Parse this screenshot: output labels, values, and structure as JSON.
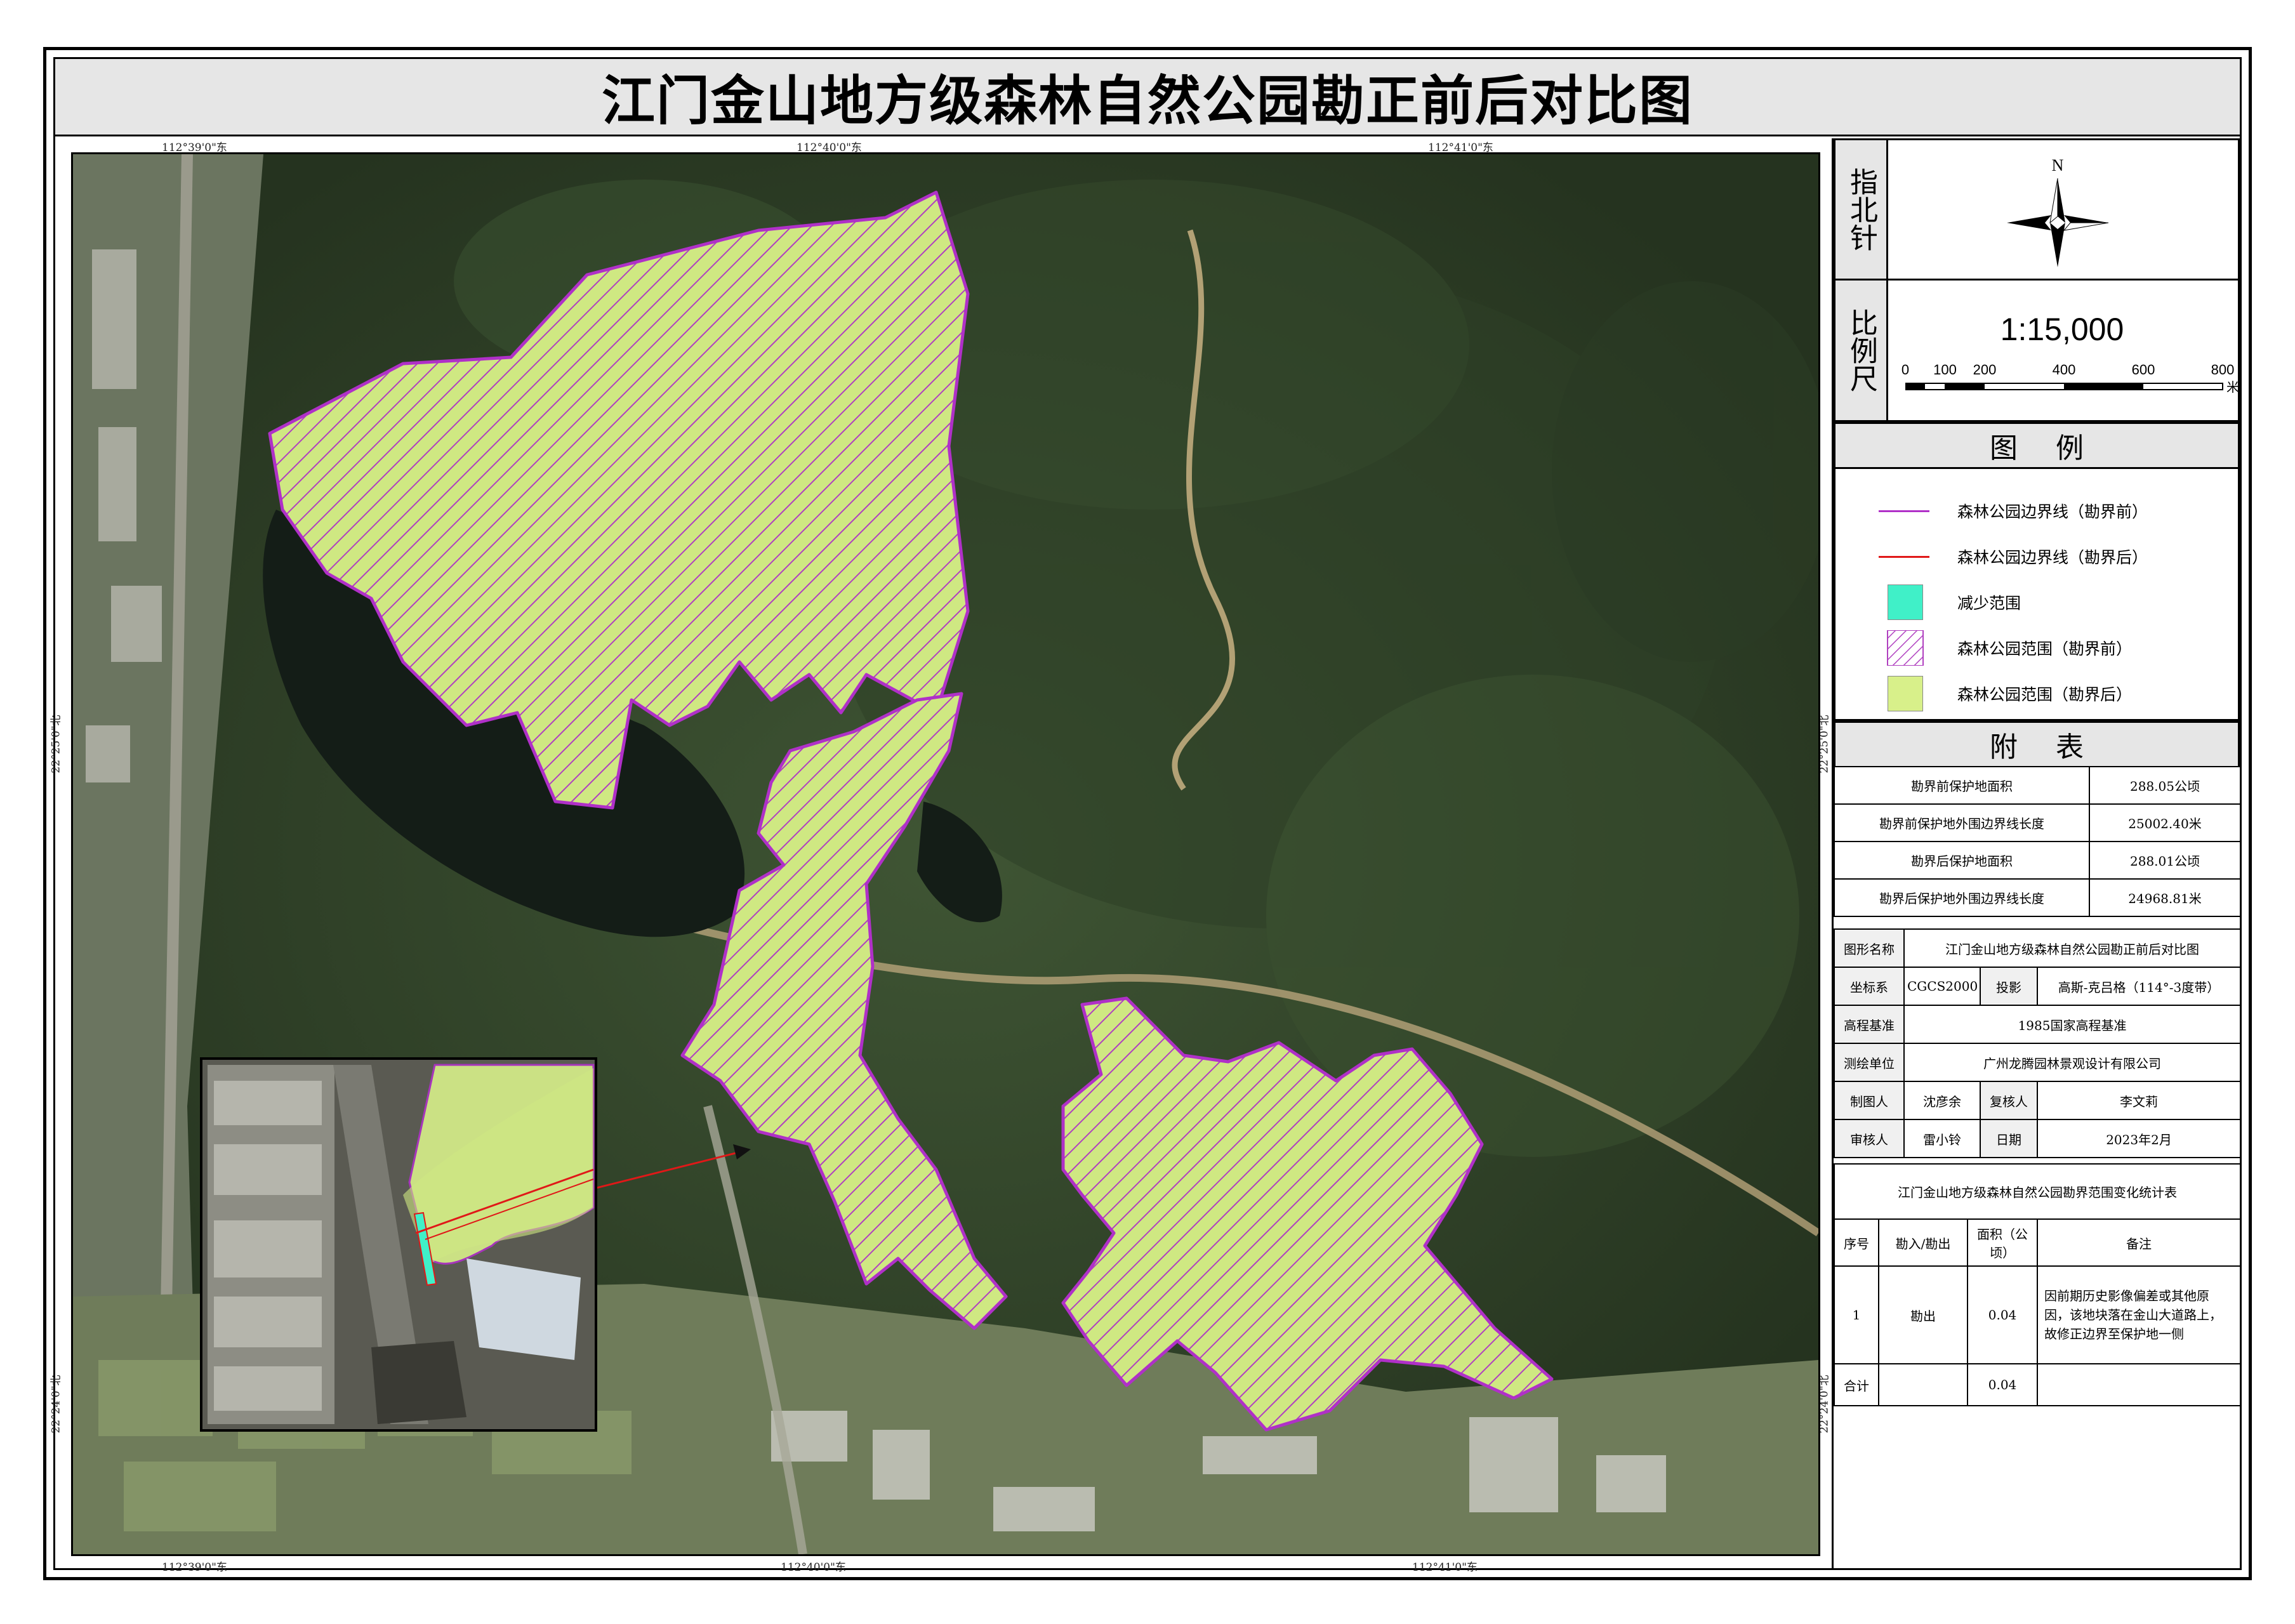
{
  "title": "江门金山地方级森林自然公园勘正前后对比图",
  "map": {
    "top_lon_labels": [
      "112°39'0\"东",
      "112°40'0\"东",
      "112°41'0\"东"
    ],
    "bottom_lon_labels": [
      "112°39'0\"东",
      "112°40'0\"东",
      "112°41'0\"东"
    ],
    "left_lat_labels": [
      "22°25'0\"北",
      "22°24'0\"北"
    ],
    "right_lat_labels": [
      "22°25'0\"北",
      "22°24'0\"北"
    ]
  },
  "north_arrow": {
    "label": "指北针",
    "letter": "N"
  },
  "scale": {
    "label": "比例尺",
    "ratio": "1:15,000",
    "ticks": [
      "0",
      "100",
      "200",
      "400",
      "600",
      "800"
    ],
    "unit": "米"
  },
  "legend": {
    "heading": "图例",
    "items": [
      {
        "label": "森林公园边界线（勘界前）",
        "color": "#b030c8",
        "kind": "line"
      },
      {
        "label": "森林公园边界线（勘界后）",
        "color": "#e01818",
        "kind": "line"
      },
      {
        "label": "减少范围",
        "color": "#40f0c8",
        "kind": "fill"
      },
      {
        "label": "森林公园范围（勘界前）",
        "color": "#b040c0",
        "kind": "hatch"
      },
      {
        "label": "森林公园范围（勘界后）",
        "color": "#d8f08a",
        "kind": "fill"
      }
    ]
  },
  "attached_table": {
    "heading": "附表",
    "rows": [
      [
        "勘界前保护地面积",
        "288.05公顷"
      ],
      [
        "勘界前保护地外围边界线长度",
        "25002.40米"
      ],
      [
        "勘界后保护地面积",
        "288.01公顷"
      ],
      [
        "勘界后保护地外围边界线长度",
        "24968.81米"
      ]
    ]
  },
  "info": {
    "map_name_label": "图形名称",
    "map_name": "江门金山地方级森林自然公园勘正前后对比图",
    "crs_label": "坐标系",
    "crs": "CGCS2000",
    "projection_label": "投影",
    "projection": "高斯-克吕格（114°-3度带）",
    "datum_label": "高程基准",
    "datum": "1985国家高程基准",
    "surveyor_label": "测绘单位",
    "surveyor": "广州龙腾园林景观设计有限公司",
    "maker_label": "制图人",
    "maker": "沈彦余",
    "checker_label": "复核人",
    "checker": "李文莉",
    "reviewer_label": "审核人",
    "reviewer": "雷小铃",
    "date_label": "日期",
    "date": "2023年2月"
  },
  "stats": {
    "heading": "江门金山地方级森林自然公园勘界范围变化统计表",
    "col_no": "序号",
    "col_type": "勘入/勘出",
    "col_area": "面积（公顷）",
    "col_note": "备注",
    "row_no": "1",
    "row_type": "勘出",
    "row_area": "0.04",
    "row_note": "因前期历史影像偏差或其他原因，该地块落在金山大道路上，故修正边界至保护地一侧",
    "total_label": "合计",
    "total_area": "0.04"
  }
}
